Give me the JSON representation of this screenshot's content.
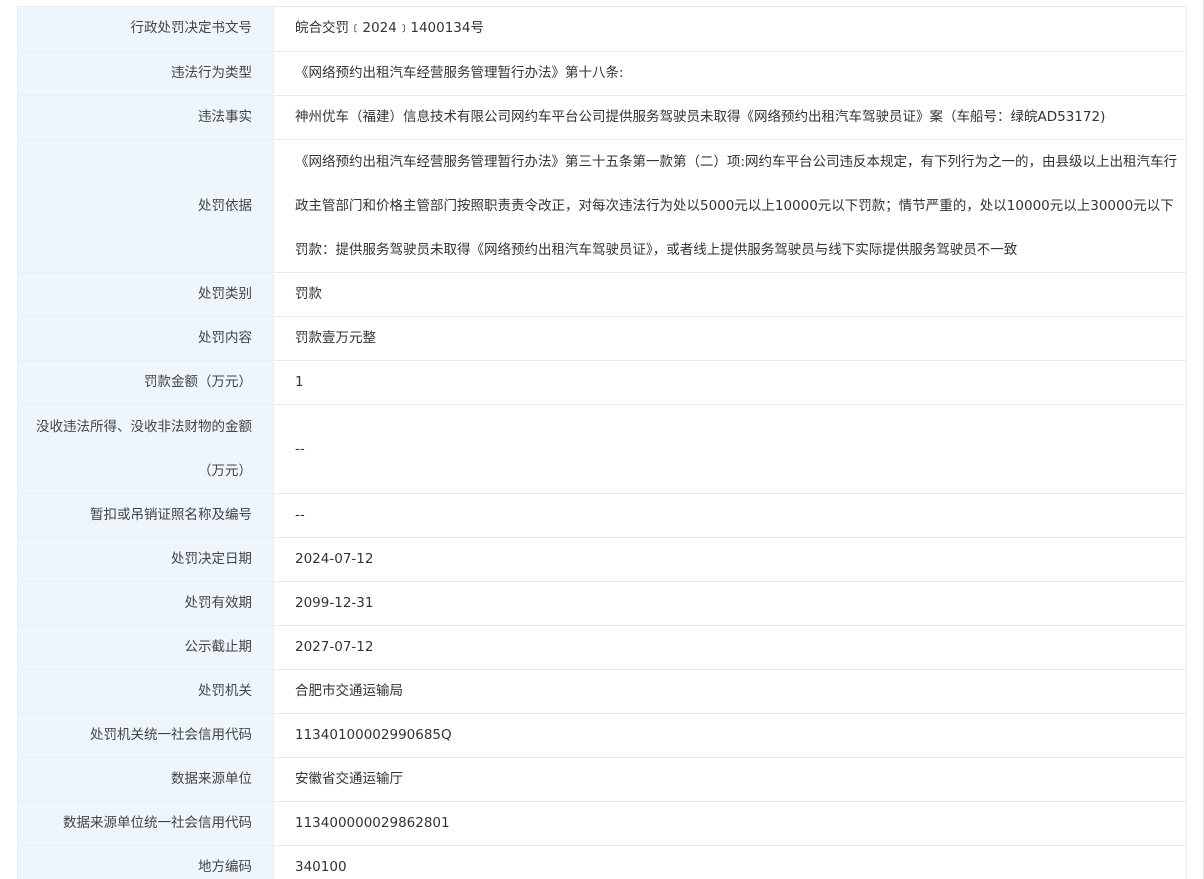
{
  "rows": [
    {
      "label": "行政处罚决定书文号",
      "value": "皖合交罚﹝2024﹞1400134号"
    },
    {
      "label": "违法行为类型",
      "value": "《网络预约出租汽车经营服务管理暂行办法》第十八条:"
    },
    {
      "label": "违法事实",
      "value": "神州优车（福建）信息技术有限公司网约车平台公司提供服务驾驶员未取得《网络预约出租汽车驾驶员证》案（车船号：绿皖AD53172)"
    },
    {
      "label": "处罚依据",
      "value": "《网络预约出租汽车经营服务管理暂行办法》第三十五条第一款第（二）项:网约车平台公司违反本规定，有下列行为之一的，由县级以上出租汽车行政主管部门和价格主管部门按照职责责令改正，对每次违法行为处以5000元以上10000元以下罚款；情节严重的，处以10000元以上30000元以下罚款：提供服务驾驶员未取得《网络预约出租汽车驾驶员证》，或者线上提供服务驾驶员与线下实际提供服务驾驶员不一致"
    },
    {
      "label": "处罚类别",
      "value": "罚款"
    },
    {
      "label": "处罚内容",
      "value": "罚款壹万元整"
    },
    {
      "label": "罚款金额（万元）",
      "value": "1"
    },
    {
      "label": "没收违法所得、没收非法财物的金额（万元）",
      "value": "--"
    },
    {
      "label": "暂扣或吊销证照名称及编号",
      "value": "--"
    },
    {
      "label": "处罚决定日期",
      "value": "2024-07-12"
    },
    {
      "label": "处罚有效期",
      "value": "2099-12-31"
    },
    {
      "label": "公示截止期",
      "value": "2027-07-12"
    },
    {
      "label": "处罚机关",
      "value": "合肥市交通运输局"
    },
    {
      "label": "处罚机关统一社会信用代码",
      "value": "11340100002990685Q"
    },
    {
      "label": "数据来源单位",
      "value": "安徽省交通运输厅"
    },
    {
      "label": "数据来源单位统一社会信用代码",
      "value": "113400000029862801"
    },
    {
      "label": "地方编码",
      "value": "340100"
    }
  ]
}
